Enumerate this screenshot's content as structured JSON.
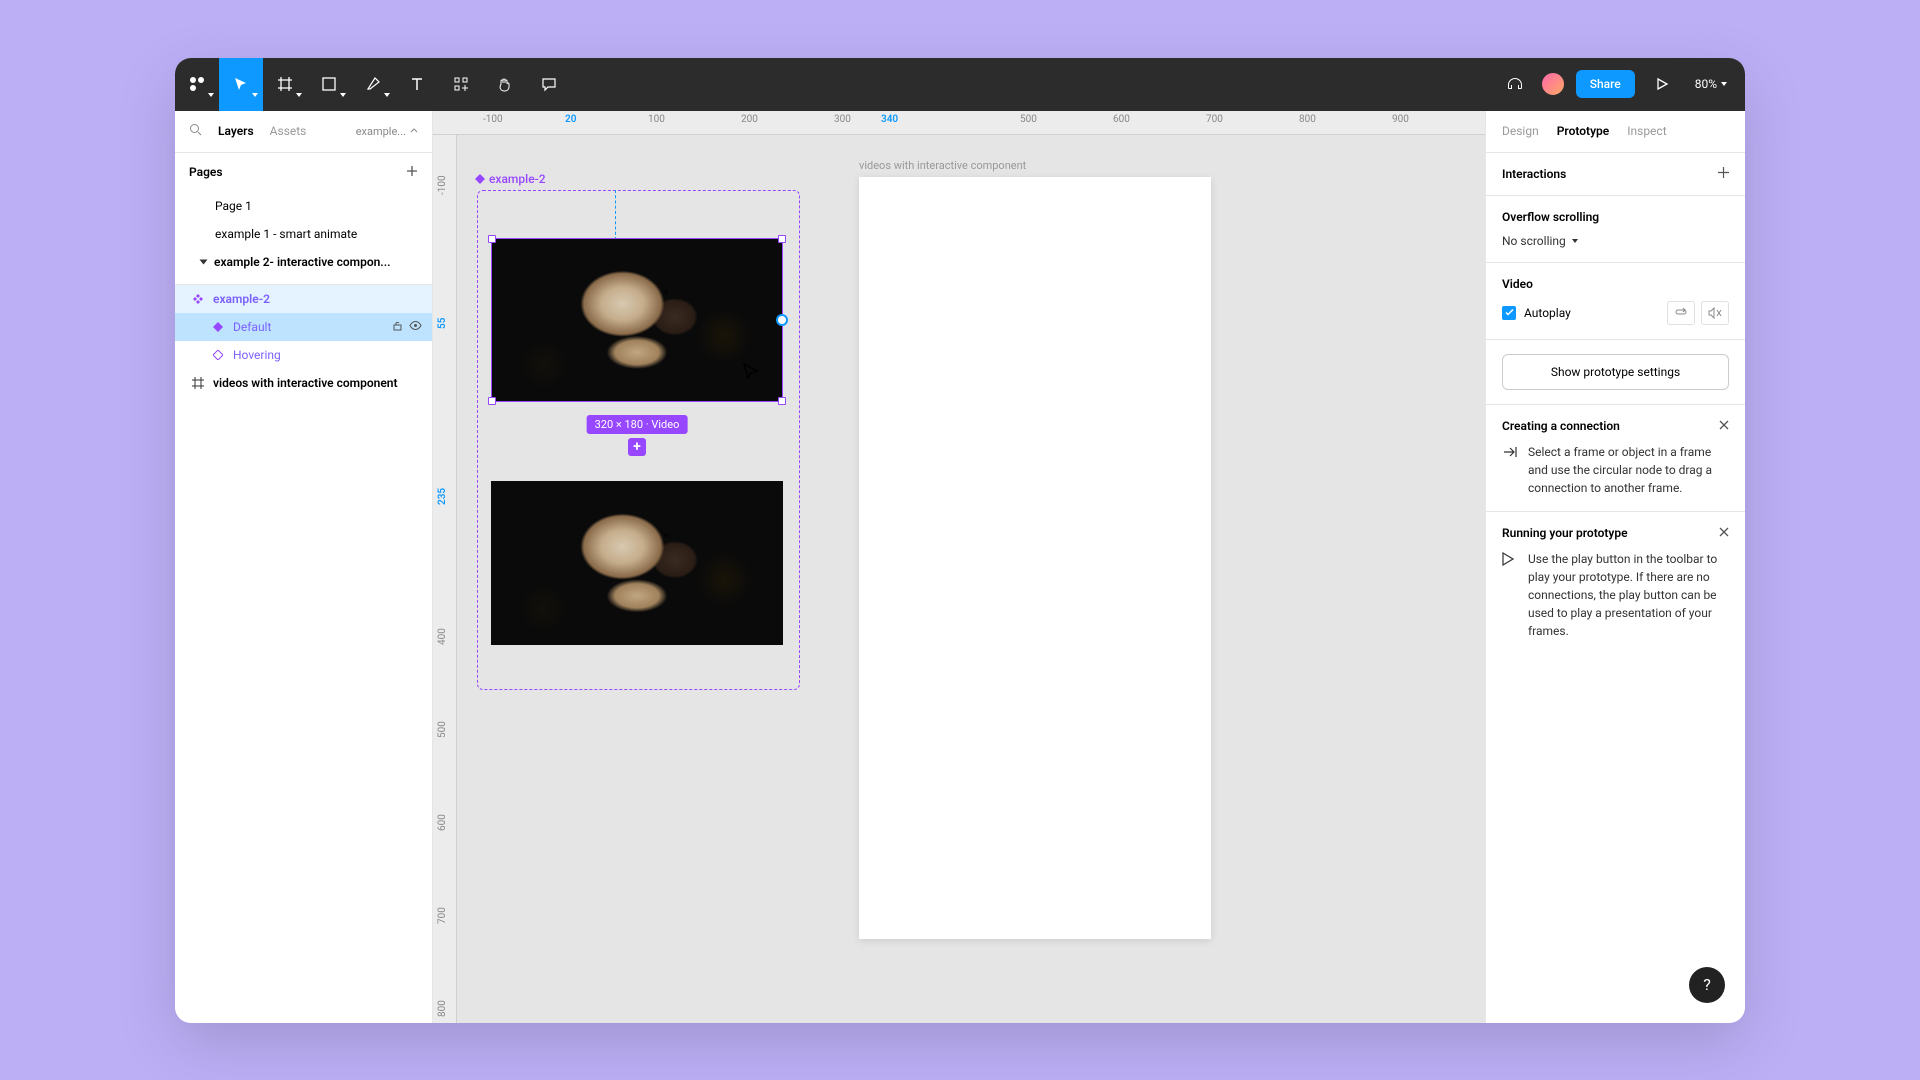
{
  "toolbar": {
    "share_label": "Share",
    "zoom": "80%"
  },
  "left_panel": {
    "tabs": {
      "layers": "Layers",
      "assets": "Assets"
    },
    "breadcrumb": "example...",
    "pages_header": "Pages",
    "pages": {
      "p1": "Page 1",
      "p2": "example 1 - smart animate",
      "p3": "example 2- interactive compon..."
    },
    "layers": {
      "comp": "example-2",
      "v_default": "Default",
      "v_hover": "Hovering",
      "frame": "videos with interactive component"
    }
  },
  "canvas": {
    "frame_vic_label": "videos with interactive component",
    "comp_label": "example-2",
    "selection_badge": "320 × 180 · Video",
    "hruler": {
      "m100": "-100",
      "p20": "20",
      "p100": "100",
      "p200": "200",
      "p300": "300",
      "p340": "340",
      "p500": "500",
      "p600": "600",
      "p700": "700",
      "p800": "800",
      "p900": "900"
    },
    "vruler": {
      "m100": "-100",
      "p55": "55",
      "p235": "235",
      "p400": "400",
      "p500": "500",
      "p600": "600",
      "p700": "700",
      "p800": "800"
    }
  },
  "right_panel": {
    "tabs": {
      "design": "Design",
      "prototype": "Prototype",
      "inspect": "Inspect"
    },
    "interactions": "Interactions",
    "overflow_header": "Overflow scrolling",
    "overflow_value": "No scrolling",
    "video_header": "Video",
    "autoplay_label": "Autoplay",
    "proto_settings": "Show prototype settings",
    "help1_title": "Creating a connection",
    "help1_body": "Select a frame or object in a frame and use the circular node to drag a connection to another frame.",
    "help2_title": "Running your prototype",
    "help2_body": "Use the play button in the toolbar to play your prototype. If there are no connections, the play button can be used to play a presentation of your frames."
  }
}
